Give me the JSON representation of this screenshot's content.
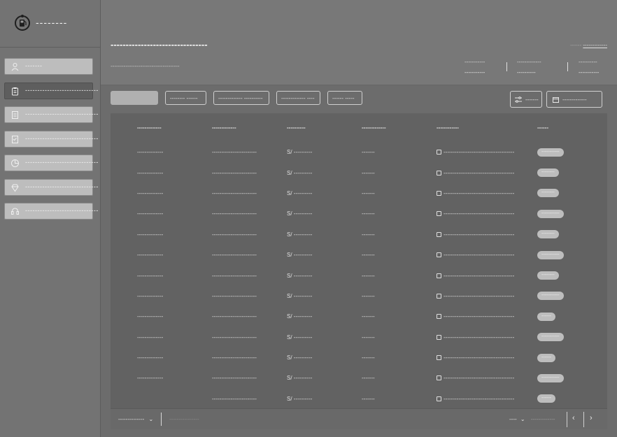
{
  "brand": {
    "name": "--------"
  },
  "sidebar": {
    "items": [
      {
        "label": "-------",
        "icon": "user-icon",
        "active": false
      },
      {
        "label": "------------------------------",
        "icon": "clipboard-icon",
        "active": true
      },
      {
        "label": "------------------------------",
        "icon": "document-icon",
        "active": false
      },
      {
        "label": "------------------------------",
        "icon": "checklist-icon",
        "active": false
      },
      {
        "label": "------------------------------",
        "icon": "pie-chart-icon",
        "active": false
      },
      {
        "label": "------------------------------",
        "icon": "diamond-icon",
        "active": false
      },
      {
        "label": "------------------------------",
        "icon": "support-icon",
        "active": false
      }
    ]
  },
  "header": {
    "title": "--------------------------------",
    "subtitle": "-------------------------------------",
    "top_link_prefix": "------",
    "top_link": "-------------",
    "stats": [
      {
        "value": "-----------",
        "label": "-----------"
      },
      {
        "value": "-------------",
        "label": "----------"
      },
      {
        "value": "----------",
        "label": "-----------"
      }
    ]
  },
  "toolbar": {
    "chips": [
      "",
      "--------  ------",
      "-------------  ----------",
      "-------------  ----",
      "------  -----"
    ],
    "filter_label": "-------",
    "date_label": "-------------"
  },
  "table": {
    "headers": [
      "-------------",
      "-------------",
      "----------",
      "-------------",
      "------------",
      "------"
    ],
    "rows": [
      {
        "c1": "--------------",
        "c2": "------------------------",
        "c3": "S/ ----------",
        "c4": "-------",
        "c5": "--------------------------------------",
        "c6": "-----------"
      },
      {
        "c1": "--------------",
        "c2": "------------------------",
        "c3": "S/ ----------",
        "c4": "-------",
        "c5": "--------------------------------------",
        "c6": "--------"
      },
      {
        "c1": "--------------",
        "c2": "------------------------",
        "c3": "S/ ----------",
        "c4": "-------",
        "c5": "--------------------------------------",
        "c6": "--------"
      },
      {
        "c1": "--------------",
        "c2": "------------------------",
        "c3": "S/ ----------",
        "c4": "-------",
        "c5": "--------------------------------------",
        "c6": "-----------"
      },
      {
        "c1": "--------------",
        "c2": "------------------------",
        "c3": "S/ ----------",
        "c4": "-------",
        "c5": "--------------------------------------",
        "c6": "--------"
      },
      {
        "c1": "--------------",
        "c2": "------------------------",
        "c3": "S/ ----------",
        "c4": "-------",
        "c5": "--------------------------------------",
        "c6": "-----------"
      },
      {
        "c1": "--------------",
        "c2": "------------------------",
        "c3": "S/ ----------",
        "c4": "-------",
        "c5": "--------------------------------------",
        "c6": "--------"
      },
      {
        "c1": "--------------",
        "c2": "------------------------",
        "c3": "S/ ----------",
        "c4": "-------",
        "c5": "--------------------------------------",
        "c6": "-----------"
      },
      {
        "c1": "--------------",
        "c2": "------------------------",
        "c3": "S/ ----------",
        "c4": "-------",
        "c5": "--------------------------------------",
        "c6": "------"
      },
      {
        "c1": "--------------",
        "c2": "------------------------",
        "c3": "S/ ----------",
        "c4": "-------",
        "c5": "--------------------------------------",
        "c6": "-----------"
      },
      {
        "c1": "--------------",
        "c2": "------------------------",
        "c3": "S/ ----------",
        "c4": "-------",
        "c5": "--------------------------------------",
        "c6": "------"
      },
      {
        "c1": "--------------",
        "c2": "------------------------",
        "c3": "S/ ----------",
        "c4": "-------",
        "c5": "--------------------------------------",
        "c6": "-----------"
      },
      {
        "c1": "",
        "c2": "------------------------",
        "c3": "S/ ----------",
        "c4": "-------",
        "c5": "--------------------------------------",
        "c6": "------"
      }
    ]
  },
  "footer": {
    "rows_per_page": "--------------",
    "range_text": "----------------",
    "page_label": "----",
    "page_of": "-------------"
  }
}
